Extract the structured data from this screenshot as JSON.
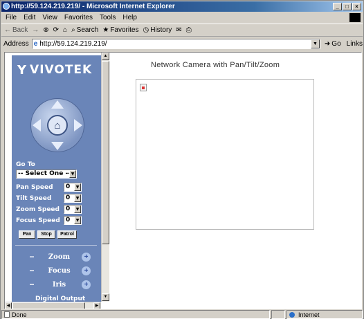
{
  "window": {
    "title": "http://59.124.219.219/ - Microsoft Internet Explorer",
    "buttons": {
      "minimize": "_",
      "maximize": "□",
      "close": "×"
    }
  },
  "menubar": {
    "items": [
      "File",
      "Edit",
      "View",
      "Favorites",
      "Tools",
      "Help"
    ]
  },
  "toolbar": {
    "back": "Back",
    "forward": "→",
    "stop": "⊗",
    "refresh": "⟳",
    "home": "⌂",
    "search": "Search",
    "favorites": "Favorites",
    "history": "History",
    "mail": "✉",
    "print": "⎙"
  },
  "addressbar": {
    "label": "Address",
    "url": "http://59.124.219.219/",
    "go": "Go",
    "links": "Links"
  },
  "leftpanel": {
    "logo_text": "VIVOTEK",
    "goto_label": "Go To",
    "goto_value": "-- Select One --",
    "pan_speed_label": "Pan Speed",
    "pan_speed_value": "0",
    "tilt_speed_label": "Tilt Speed",
    "tilt_speed_value": "0",
    "zoom_speed_label": "Zoom Speed",
    "zoom_speed_value": "0",
    "focus_speed_label": "Focus Speed",
    "focus_speed_value": "0",
    "pan_button": "Pan",
    "stop_button": "Stop",
    "patrol_button": "Patrol",
    "zoom_label": "Zoom",
    "focus_label": "Focus",
    "iris_label": "Iris",
    "minus": "−",
    "plus": "+",
    "digital_output_label": "Digital Output"
  },
  "main": {
    "title": "Network Camera with Pan/Tilt/Zoom"
  },
  "statusbar": {
    "status_text": "Done",
    "zone_text": "Internet"
  }
}
